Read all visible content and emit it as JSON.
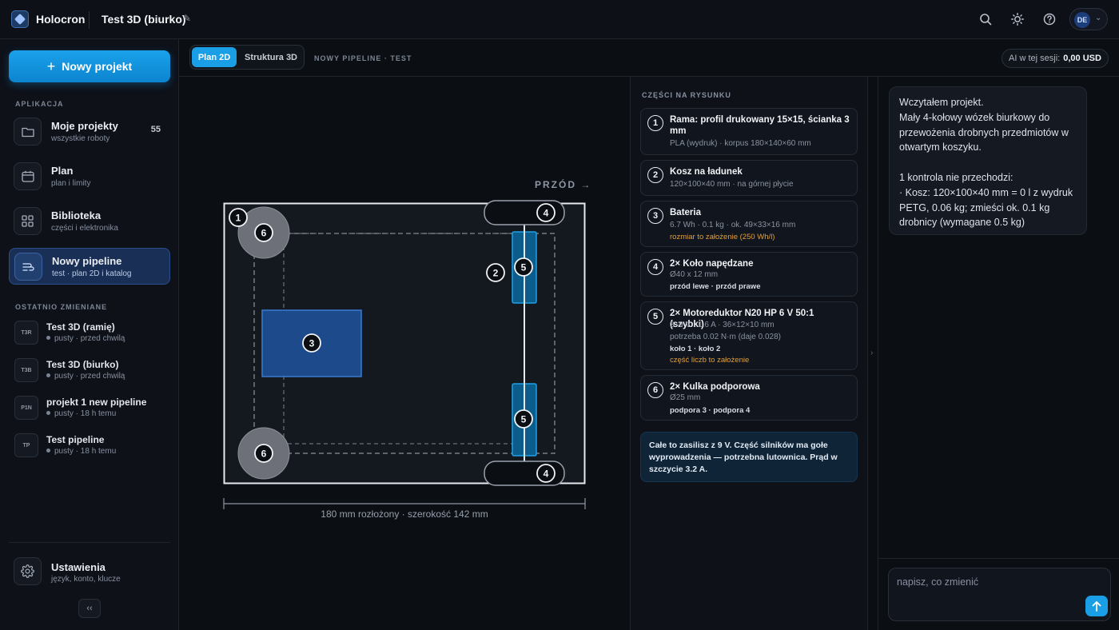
{
  "app": {
    "name": "Holocron",
    "project_title": "Test 3D (biurko)"
  },
  "header_icons": [
    "search-icon",
    "theme-icon",
    "help-icon"
  ],
  "user": {
    "initials": "DE"
  },
  "sidebar": {
    "new_project_label": "Nowy projekt",
    "apps_label": "APLIKACJA",
    "items": [
      {
        "title": "Moje projekty",
        "subtitle": "wszystkie roboty",
        "count": "55",
        "icon": "folder-icon"
      },
      {
        "title": "Plan",
        "subtitle": "plan i limity",
        "icon": "calendar-icon"
      },
      {
        "title": "Biblioteka",
        "subtitle": "części i elektronika",
        "icon": "grid-icon"
      },
      {
        "title": "Nowy pipeline",
        "subtitle": "test · plan 2D i katalog",
        "icon": "pipeline-icon",
        "active": true
      }
    ],
    "recent_label": "OSTATNIO ZMIENIANE",
    "recent": [
      {
        "badge": "T3R",
        "title": "Test 3D (ramię)",
        "subtitle": "pusty · przed chwilą"
      },
      {
        "badge": "T3B",
        "title": "Test 3D (biurko)",
        "subtitle": "pusty · przed chwilą"
      },
      {
        "badge": "P1N",
        "title": "projekt 1 new pipeline",
        "subtitle": "pusty · 18 h temu"
      },
      {
        "badge": "TP",
        "title": "Test pipeline",
        "subtitle": "pusty · 18 h temu"
      }
    ],
    "settings": {
      "title": "Ustawienia",
      "subtitle": "język, konto, klucze"
    },
    "collapse_label": "‹‹"
  },
  "toolbar": {
    "tab_2d": "Plan 2D",
    "tab_3d": "Struktura 3D",
    "pipeline_label": "NOWY PIPELINE · TEST",
    "ai_cost_label": "AI w tej sesji:",
    "ai_cost_value": "0,00 USD"
  },
  "canvas": {
    "front_label": "PRZÓD →",
    "dimension_label": "180 mm rozłożony · szerokość 142 mm"
  },
  "parts": {
    "heading": "CZĘŚCI NA RYSUNKU",
    "items": [
      {
        "num": "1",
        "title": "Rama: profil drukowany 15×15, ścianka 3 mm",
        "lines": [
          {
            "text": "PLA (wydruk) · korpus 180×140×60 mm",
            "kind": "muted"
          }
        ]
      },
      {
        "num": "2",
        "title": "Kosz na ładunek",
        "lines": [
          {
            "text": "120×100×40 mm · na górnej płycie",
            "kind": "muted"
          }
        ]
      },
      {
        "num": "3",
        "title": "Bateria",
        "lines": [
          {
            "text": "6.7 Wh · 0.1 kg · ok. 49×33×16 mm",
            "kind": "muted"
          },
          {
            "text": "rozmiar to założenie (250 Wh/l)",
            "kind": "warn"
          }
        ]
      },
      {
        "num": "4",
        "title": "2× Koło napędzane",
        "lines": [
          {
            "text": "Ø40 x 12 mm",
            "kind": "muted"
          },
          {
            "text": "przód lewe · przód prawe",
            "kind": "strong"
          }
        ]
      },
      {
        "num": "5",
        "title": "2× Motoreduktor N20 HP 6 V 50:1 (szybki)",
        "lines": [
          {
            "text": "3–9 V · 1.6 A · 36×12×10 mm",
            "kind": "muted"
          },
          {
            "text": "potrzeba 0.02 N·m (daje 0.028)",
            "kind": "muted"
          },
          {
            "text": "koło 1 · koło 2",
            "kind": "strong"
          },
          {
            "text": "część liczb to założenie",
            "kind": "warn"
          }
        ]
      },
      {
        "num": "6",
        "title": "2× Kulka podporowa",
        "lines": [
          {
            "text": "Ø25 mm",
            "kind": "muted"
          },
          {
            "text": "podpora 3 · podpora 4",
            "kind": "strong"
          }
        ]
      }
    ],
    "note": "Całe to zasilisz z 9 V. Część silników ma gołe wyprowadzenia — potrzebna lutownica. Prąd w szczycie 3.2 A."
  },
  "chat": {
    "message": [
      "Wczytałem projekt.",
      "Mały 4-kołowy wózek biurkowy do przewożenia drobnych przedmiotów w otwartym koszyku.",
      "",
      "1 kontrola nie przechodzi:",
      "· Kosz: 120×100×40 mm = 0 l z wydruk PETG, 0.06 kg; zmieści ok. 0.1 kg drobnicy (wymagane 0.5 kg)"
    ],
    "input_placeholder": "napisz, co zmienić"
  },
  "colors": {
    "accent": "#1a9ee6",
    "warn": "#e3a03a",
    "active_nav": "#1a2f55",
    "component_blue": "#1d4a8a"
  }
}
